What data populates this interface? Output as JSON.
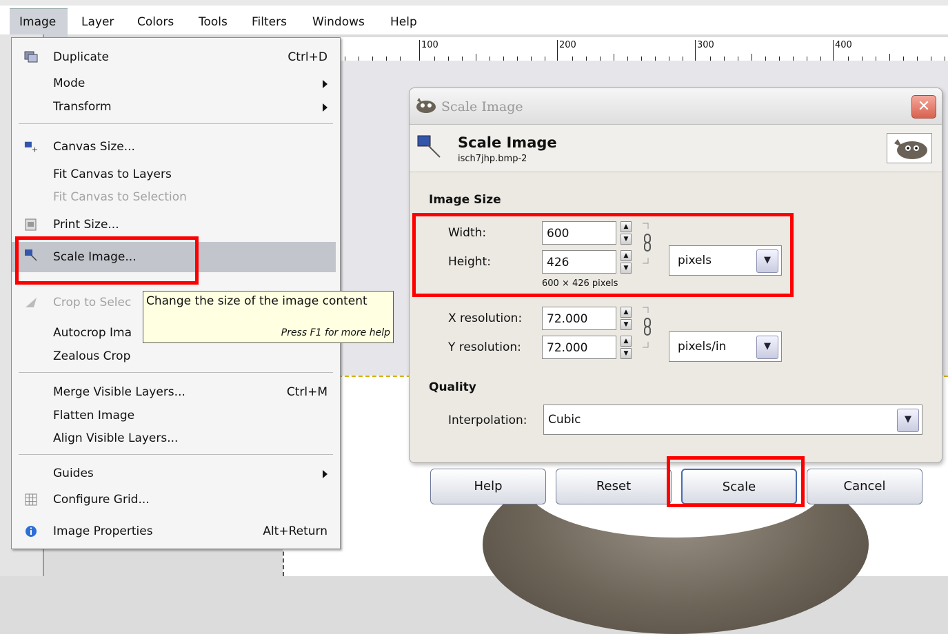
{
  "menubar": {
    "items": [
      "Image",
      "Layer",
      "Colors",
      "Tools",
      "Filters",
      "Windows",
      "Help"
    ]
  },
  "ruler": {
    "labels": [
      "100",
      "200",
      "300",
      "400"
    ]
  },
  "image_menu": {
    "items": {
      "duplicate": {
        "label": "Duplicate",
        "shortcut": "Ctrl+D"
      },
      "mode": {
        "label": "Mode"
      },
      "transform": {
        "label": "Transform"
      },
      "canvas_size": {
        "label": "Canvas Size..."
      },
      "fit_canvas_layers": {
        "label": "Fit Canvas to Layers"
      },
      "fit_canvas_selection": {
        "label": "Fit Canvas to Selection"
      },
      "print_size": {
        "label": "Print Size..."
      },
      "scale_image": {
        "label": "Scale Image..."
      },
      "crop_selection": {
        "label": "Crop to Selec"
      },
      "autocrop": {
        "label": "Autocrop Ima"
      },
      "zealous_crop": {
        "label": "Zealous Crop"
      },
      "merge_visible": {
        "label": "Merge Visible Layers...",
        "shortcut": "Ctrl+M"
      },
      "flatten": {
        "label": "Flatten Image"
      },
      "align_visible": {
        "label": "Align Visible Layers..."
      },
      "guides": {
        "label": "Guides"
      },
      "configure_grid": {
        "label": "Configure Grid..."
      },
      "image_properties": {
        "label": "Image Properties",
        "shortcut": "Alt+Return"
      }
    }
  },
  "tooltip": {
    "text": "Change the size of the image content",
    "hint": "Press F1 for more help"
  },
  "dialog": {
    "window_title": "Scale Image",
    "header_title": "Scale Image",
    "header_subtitle": "isch7jhp.bmp-2",
    "image_size": {
      "section_label": "Image Size",
      "width_label": "Width:",
      "width_value": "600",
      "height_label": "Height:",
      "height_value": "426",
      "size_summary": "600 × 426 pixels",
      "unit": "pixels",
      "xres_label": "X resolution:",
      "xres_value": "72.000",
      "yres_label": "Y resolution:",
      "yres_value": "72.000",
      "res_unit": "pixels/in"
    },
    "quality": {
      "section_label": "Quality",
      "interp_label": "Interpolation:",
      "interp_value": "Cubic"
    },
    "buttons": {
      "help": "Help",
      "reset": "Reset",
      "scale": "Scale",
      "cancel": "Cancel"
    }
  },
  "colors": {
    "highlight": "#ff0000",
    "menu_hover": "#c2c5cc",
    "tooltip_bg": "#ffffe1"
  }
}
